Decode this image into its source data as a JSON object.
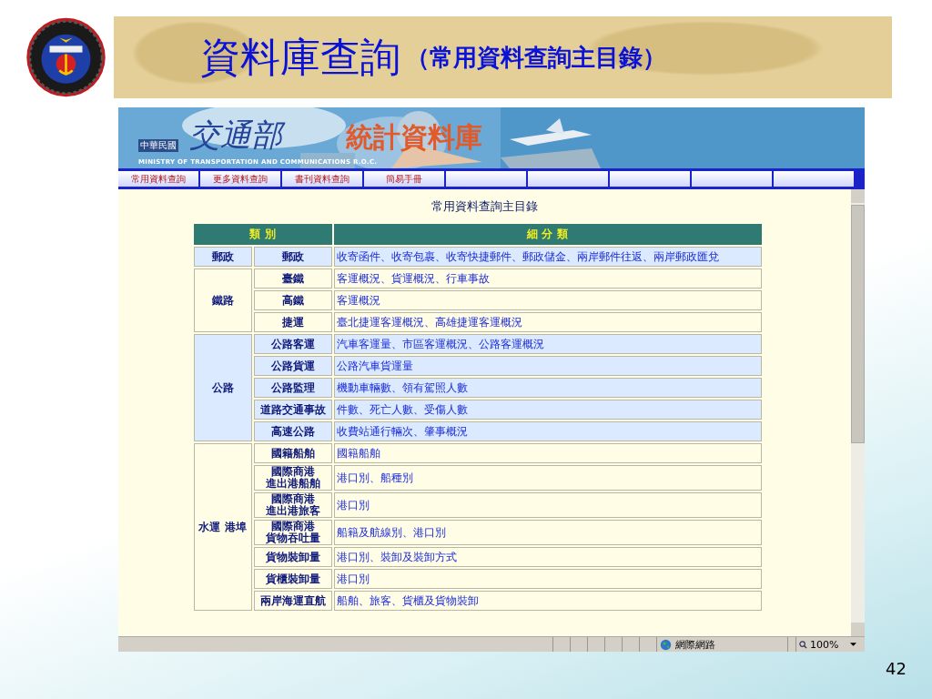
{
  "slide": {
    "title": "資料庫查詢",
    "subtitle": "（常用資料查詢主目錄）",
    "page_number": "42"
  },
  "banner": {
    "country": "中華民國",
    "ministry": "交通部",
    "database": "統計資料庫",
    "english": "MINISTRY OF TRANSPORTATION AND COMMUNICATIONS R.O.C."
  },
  "nav": [
    {
      "label": "常用資料查詢"
    },
    {
      "label": "更多資料查詢"
    },
    {
      "label": "書刊資料查詢"
    },
    {
      "label": "簡易手冊"
    }
  ],
  "page_heading": "常用資料查詢主目錄",
  "table": {
    "columns": [
      "類 別",
      "細 分 類"
    ],
    "groups": [
      {
        "category": "郵政",
        "rows": [
          {
            "sub": "郵政",
            "detail": "收寄函件、收寄包裹、收寄快捷郵件、郵政儲金、兩岸郵件往返、兩岸郵政匯兌"
          }
        ]
      },
      {
        "category": "鐵路",
        "rows": [
          {
            "sub": "臺鐵",
            "detail": "客運概況、貨運概況、行車事故"
          },
          {
            "sub": "高鐵",
            "detail": "客運概況"
          },
          {
            "sub": "捷運",
            "detail": "臺北捷運客運概況、高雄捷運客運概況"
          }
        ]
      },
      {
        "category": "公路",
        "rows": [
          {
            "sub": "公路客運",
            "detail": "汽車客運量、市區客運概況、公路客運概況"
          },
          {
            "sub": "公路貨運",
            "detail": "公路汽車貨運量"
          },
          {
            "sub": "公路監理",
            "detail": "機動車輛數、領有駕照人數"
          },
          {
            "sub": "道路交通事故",
            "detail": "件數、死亡人數、受傷人數"
          },
          {
            "sub": "高速公路",
            "detail": "收費站通行輛次、肇事概況"
          }
        ]
      },
      {
        "category": "水運 港埠",
        "rows": [
          {
            "sub": "國籍船舶",
            "detail": "國籍船舶"
          },
          {
            "sub_lines": [
              "國際商港",
              "進出港船舶"
            ],
            "detail": "港口別、船種別"
          },
          {
            "sub_lines": [
              "國際商港",
              "進出港旅客"
            ],
            "detail": "港口別"
          },
          {
            "sub_lines": [
              "國際商港",
              "貨物吞吐量"
            ],
            "detail": "船籍及航線別、港口別"
          },
          {
            "sub": "貨物裝卸量",
            "detail": "港口別、裝卸及裝卸方式"
          },
          {
            "sub": "貨櫃裝卸量",
            "detail": "港口別"
          },
          {
            "sub": "兩岸海運直航",
            "detail": "船舶、旅客、貨櫃及貨物裝卸"
          }
        ]
      }
    ]
  },
  "status_bar": {
    "zone": "網際網路",
    "zoom": "100%"
  }
}
